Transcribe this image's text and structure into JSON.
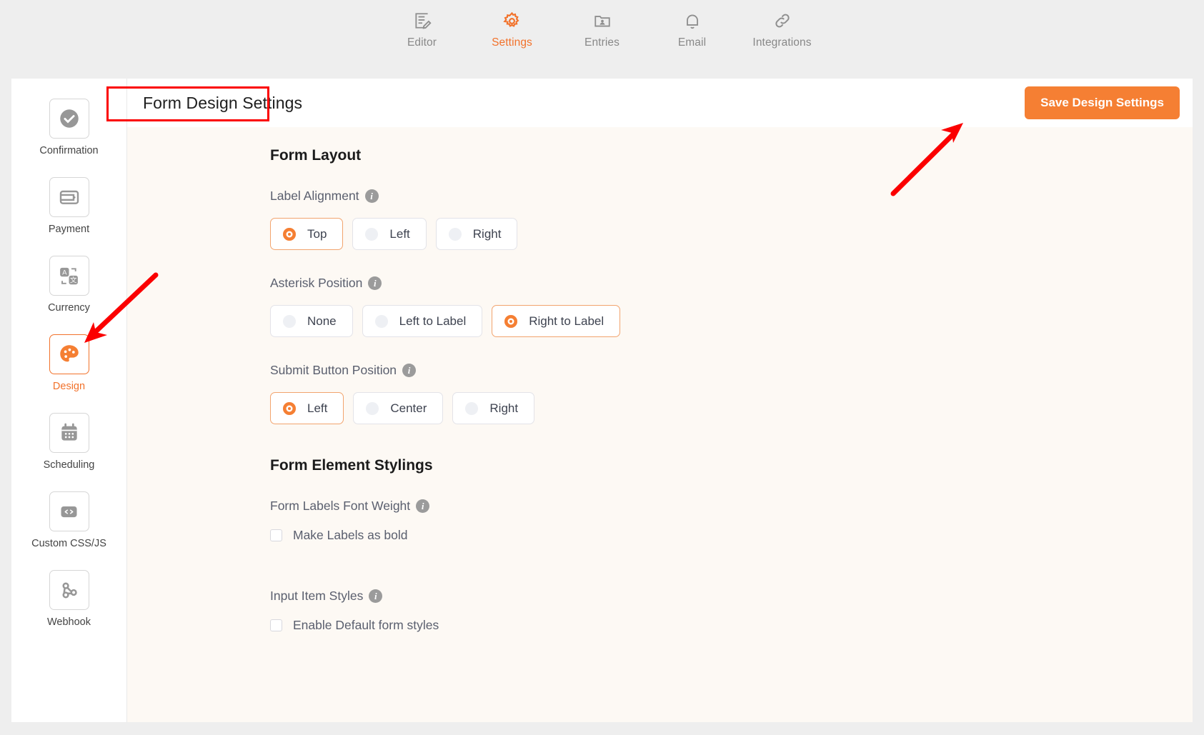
{
  "topnav": {
    "items": [
      {
        "label": "Editor",
        "icon": "editor-icon",
        "active": false
      },
      {
        "label": "Settings",
        "icon": "gear-icon",
        "active": true
      },
      {
        "label": "Entries",
        "icon": "entries-icon",
        "active": false
      },
      {
        "label": "Email",
        "icon": "bell-icon",
        "active": false
      },
      {
        "label": "Integrations",
        "icon": "link-icon",
        "active": false
      }
    ]
  },
  "sidebar": {
    "items": [
      {
        "label": "Confirmation",
        "icon": "check-circle-icon",
        "active": false
      },
      {
        "label": "Payment",
        "icon": "wallet-icon",
        "active": false
      },
      {
        "label": "Currency",
        "icon": "translate-icon",
        "active": false
      },
      {
        "label": "Design",
        "icon": "palette-icon",
        "active": true
      },
      {
        "label": "Scheduling",
        "icon": "calendar-icon",
        "active": false
      },
      {
        "label": "Custom CSS/JS",
        "icon": "code-icon",
        "active": false
      },
      {
        "label": "Webhook",
        "icon": "webhook-icon",
        "active": false
      }
    ]
  },
  "header": {
    "title": "Form Design Settings",
    "save_label": "Save Design Settings"
  },
  "sections": {
    "form_layout_title": "Form Layout",
    "form_element_stylings_title": "Form Element Stylings"
  },
  "fields": {
    "label_alignment": {
      "label": "Label Alignment",
      "info": "i",
      "options": [
        {
          "label": "Top",
          "selected": true
        },
        {
          "label": "Left",
          "selected": false
        },
        {
          "label": "Right",
          "selected": false
        }
      ]
    },
    "asterisk_position": {
      "label": "Asterisk Position",
      "info": "i",
      "options": [
        {
          "label": "None",
          "selected": false
        },
        {
          "label": "Left to Label",
          "selected": false
        },
        {
          "label": "Right to Label",
          "selected": true
        }
      ]
    },
    "submit_button_position": {
      "label": "Submit Button Position",
      "info": "i",
      "options": [
        {
          "label": "Left",
          "selected": true
        },
        {
          "label": "Center",
          "selected": false
        },
        {
          "label": "Right",
          "selected": false
        }
      ]
    },
    "form_labels_font_weight": {
      "label": "Form Labels Font Weight",
      "info": "i",
      "checkbox_label": "Make Labels as bold",
      "checked": false
    },
    "input_item_styles": {
      "label": "Input Item Styles",
      "info": "i",
      "checkbox_label": "Enable Default form styles",
      "checked": false
    }
  },
  "colors": {
    "accent": "#f57f33",
    "accent_text": "#f2722b",
    "panel_bg": "#fdf9f4",
    "page_bg": "#eeeeee",
    "annotation": "#fb0000"
  },
  "annotations": {
    "title_highlight_box": true,
    "arrow_to_save_button": true,
    "arrow_to_design_tab": true
  }
}
